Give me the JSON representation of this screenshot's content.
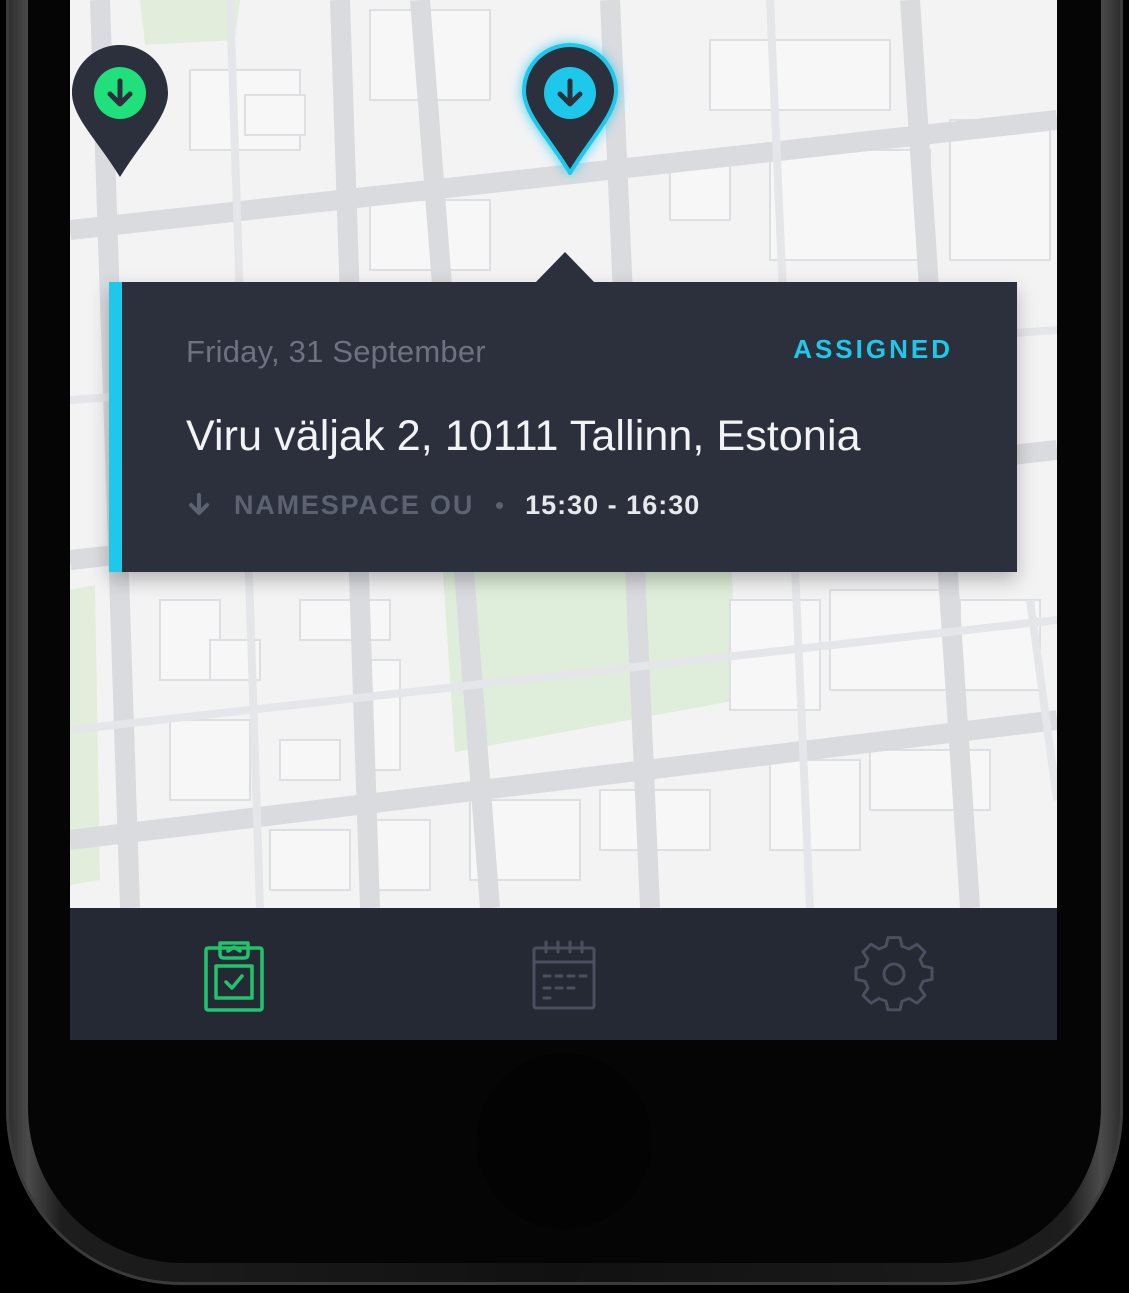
{
  "popup": {
    "date": "Friday, 31 September",
    "status": "ASSIGNED",
    "address": "Viru väljak 2, 10111 Tallinn, Estonia",
    "company": "NAMESPACE OU",
    "time": "15:30 - 16:30"
  },
  "map_pins": [
    {
      "icon": "download-arrow-icon",
      "color": "#1fe07a"
    },
    {
      "icon": "download-arrow-icon",
      "color": "#1ec8ea",
      "selected": true
    }
  ],
  "tabs": [
    {
      "icon": "clipboard-check-icon",
      "active": true
    },
    {
      "icon": "calendar-icon",
      "active": false
    },
    {
      "icon": "gear-icon",
      "active": false
    }
  ],
  "colors": {
    "accent": "#1ec8ea",
    "active_tab": "#1fc46c",
    "card_bg": "#2c303c",
    "tabbar_bg": "#252933"
  }
}
